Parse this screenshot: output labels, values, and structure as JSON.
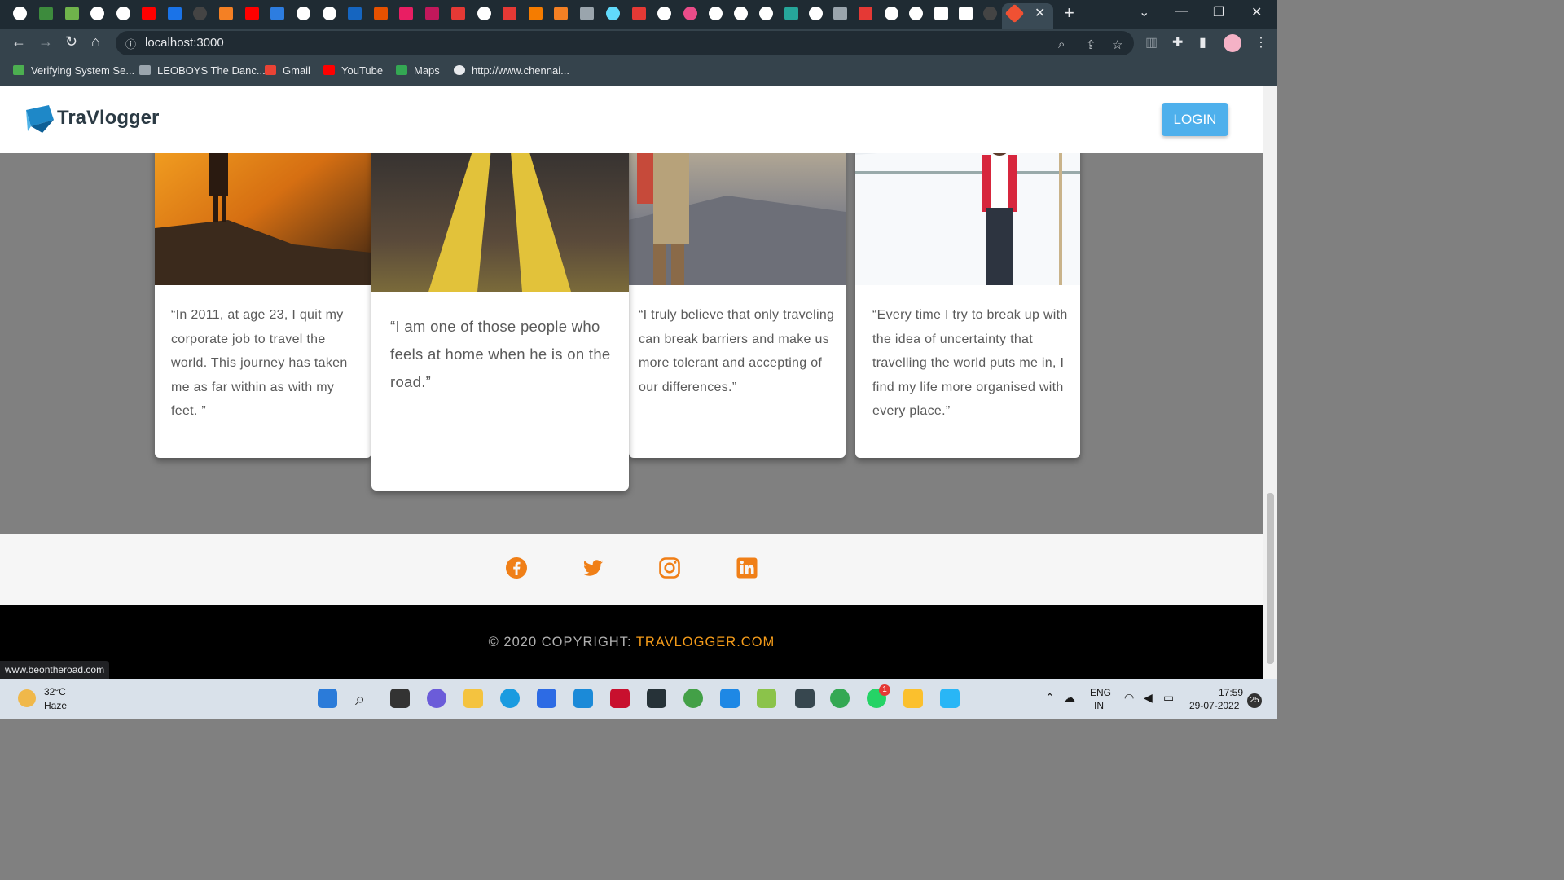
{
  "browser": {
    "tab_close": "✕",
    "new_tab": "+",
    "window_controls": [
      "⌄",
      "—",
      "❐",
      "✕"
    ],
    "url": "localhost:3000",
    "bookmarks": [
      {
        "label": "Verifying System Se...",
        "icon_color": "#4caf50"
      },
      {
        "label": "LEOBOYS The Danc...",
        "icon_color": "#9aa5ad"
      },
      {
        "label": "Gmail",
        "icon_color": "#ea4335"
      },
      {
        "label": "YouTube",
        "icon_color": "#ff0000"
      },
      {
        "label": "Maps",
        "icon_color": "#34a853"
      },
      {
        "label": "http://www.chennai...",
        "icon_color": "#e8eaed"
      }
    ]
  },
  "site": {
    "logo_text": "TraVlogger",
    "login_label": "LOGIN",
    "cards": [
      {
        "quote": "“In 2011, at age 23, I quit my corporate job to travel the world. This journey has taken me as far within as with my feet. ”"
      },
      {
        "quote": "“I am one of those people who feels at home when he is on the road.”"
      },
      {
        "quote": "“I truly believe that only traveling can break barriers and make us more tolerant and accepting of our differences.”"
      },
      {
        "quote": "“Every time I try to break up with the idea of uncertainty that travelling the world puts me in, I find my life more organised with every place.”"
      }
    ],
    "social_icons": [
      "facebook-icon",
      "twitter-icon",
      "instagram-icon",
      "linkedin-icon"
    ],
    "copyright_prefix": "© 2020 COPYRIGHT: ",
    "copyright_brand": "TRAVLOGGER.COM",
    "accent_color": "#f07f17",
    "hover_link": "www.beontheroad.com"
  },
  "taskbar": {
    "temperature": "32°C",
    "weather": "Haze",
    "language": "ENG",
    "region": "IN",
    "time": "17:59",
    "date": "29-07-2022",
    "notification_count": "25",
    "whatsapp_badge": "1"
  }
}
